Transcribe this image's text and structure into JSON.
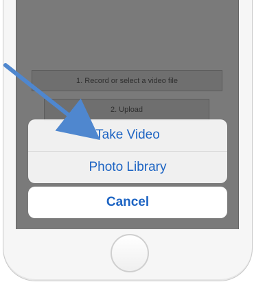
{
  "screen": {
    "buttons": {
      "record_label": "1. Record or select a video file",
      "upload_label": "2. Upload"
    }
  },
  "action_sheet": {
    "items": [
      {
        "label": "Take Video"
      },
      {
        "label": "Photo Library"
      }
    ],
    "cancel_label": "Cancel"
  },
  "colors": {
    "action_blue": "#1d64c3",
    "annotation_arrow": "#4f87cf"
  },
  "icons": {
    "home_button": "home-button-icon",
    "annotation": "arrow-icon"
  }
}
